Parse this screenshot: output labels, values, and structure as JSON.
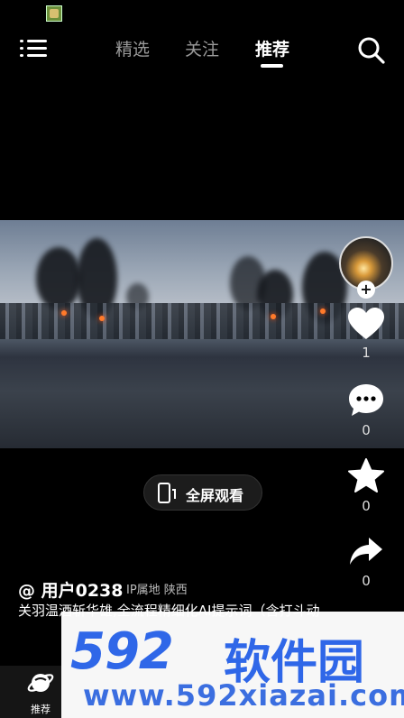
{
  "nav": {
    "tabs": [
      {
        "label": "精选",
        "active": false
      },
      {
        "label": "关注",
        "active": false
      },
      {
        "label": "推荐",
        "active": true
      }
    ]
  },
  "video": {
    "fullscreen_label": "全屏观看"
  },
  "actions": {
    "like_count": "1",
    "comment_count": "0",
    "favorite_count": "0",
    "share_count": "0"
  },
  "author": {
    "username": "@ 用户0238",
    "ip_location": "IP属地 陕西"
  },
  "description": "关羽温酒斩华雄,全流程精细化AI提示词（含打斗动",
  "bottom_nav": {
    "recommend_label": "推荐"
  },
  "watermark": {
    "logo": "592",
    "brand": "软件园",
    "url": "www.592xiazai.com"
  },
  "colors": {
    "background": "#000000",
    "watermark_blue": "#2f67e8",
    "inactive_tab": "#9a9a9a"
  },
  "icons": [
    "menu-icon",
    "search-icon",
    "like-heart-icon",
    "comment-icon",
    "favorite-star-icon",
    "share-arrow-icon",
    "phone-fullscreen-icon",
    "planet-icon"
  ]
}
